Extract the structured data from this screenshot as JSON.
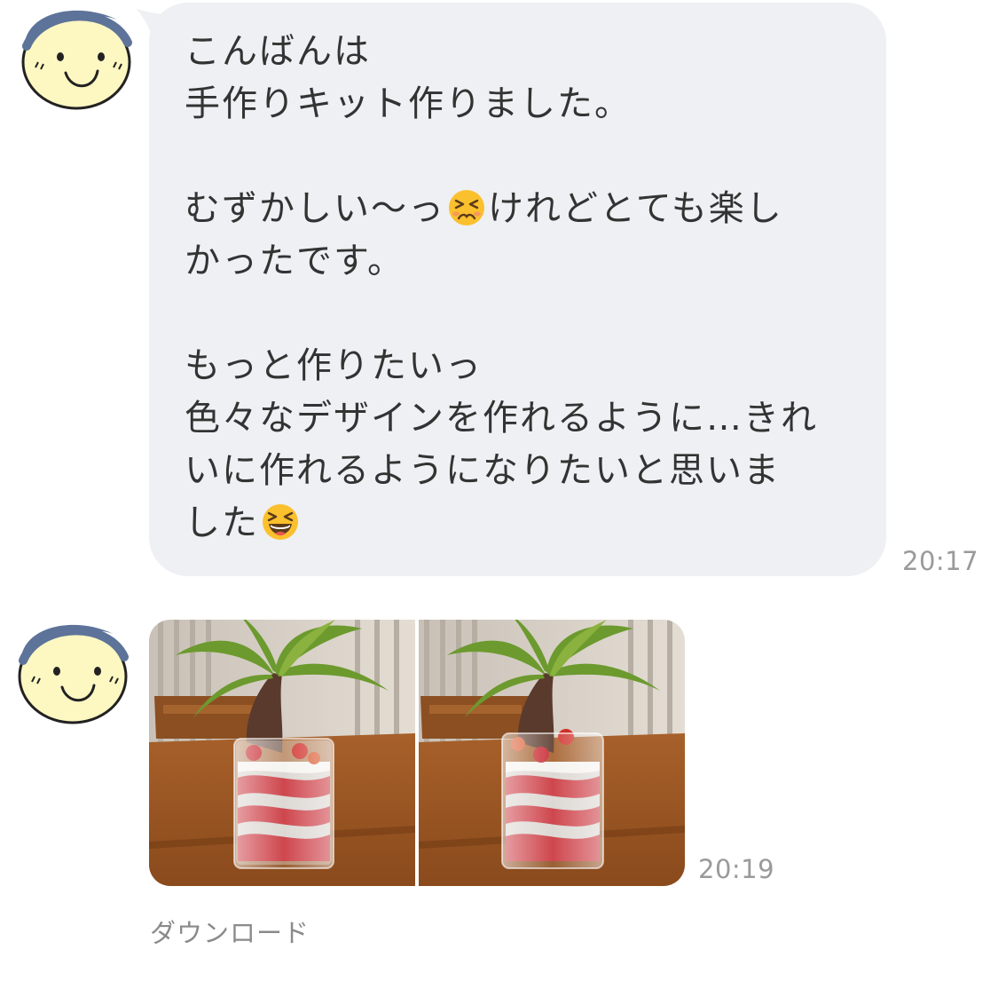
{
  "messages": [
    {
      "sender_avatar": "smiley-face-avatar",
      "lines": [
        {
          "text": "こんばんは"
        },
        {
          "text": "手作りキット作りました。"
        },
        {
          "text": ""
        },
        {
          "before": "むずかしい〜っ",
          "emoji": "persevering-face-emoji",
          "after": "けれどとても楽し"
        },
        {
          "text": "かったです。"
        },
        {
          "text": ""
        },
        {
          "text": "もっと作りたいっ"
        },
        {
          "text": "色々なデザインを作れるように…きれ"
        },
        {
          "text": "いに作れるようになりたいと思いま"
        },
        {
          "before": "した",
          "emoji": "grinning-squinting-face-emoji",
          "after": ""
        }
      ],
      "time": "20:17"
    },
    {
      "sender_avatar": "smiley-face-avatar",
      "photos": [
        {
          "name": "plant-in-sand-jar-photo-1"
        },
        {
          "name": "plant-in-sand-jar-photo-2"
        }
      ],
      "time": "20:19",
      "download_label": "ダウンロード"
    }
  ],
  "colors": {
    "bubble_bg": "#eff0f3",
    "text": "#333333",
    "timestamp": "#9a9a9a",
    "avatar_face": "#fdf7c2",
    "avatar_hat": "#5d7399"
  }
}
